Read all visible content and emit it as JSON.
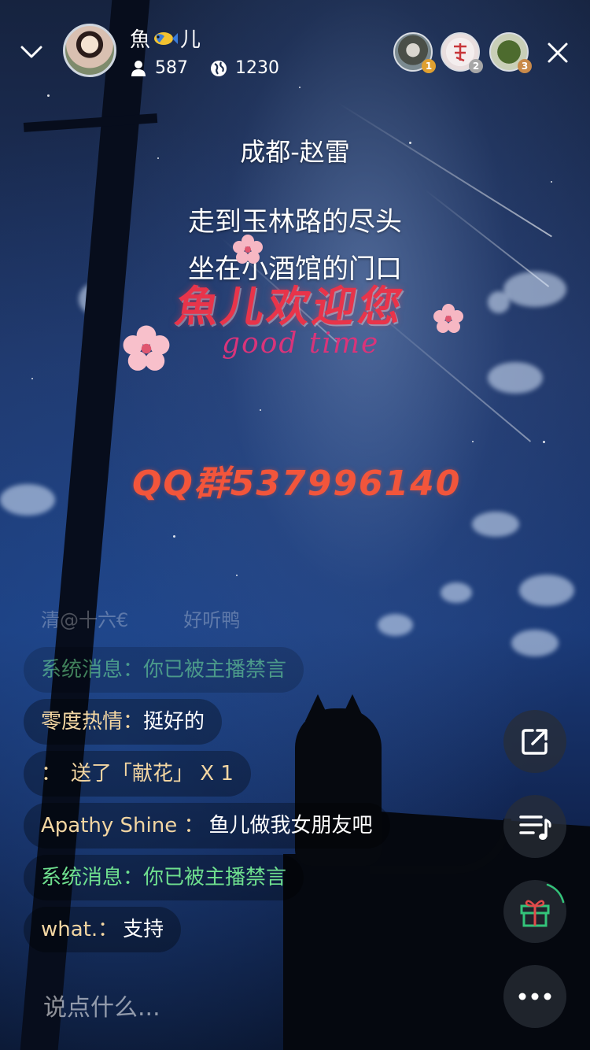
{
  "header": {
    "anchor_name_prefix": "魚",
    "anchor_name_suffix": "儿",
    "fans_count": "587",
    "hot_count": "1230",
    "viewers": [
      {
        "rank": "1",
        "rank_color": "#e0a030"
      },
      {
        "rank": "2",
        "rank_color": "#a7a7a7"
      },
      {
        "rank": "3",
        "rank_color": "#c98a4a"
      }
    ]
  },
  "overlay": {
    "lyric_title": "成都-赵雷",
    "lyric_line1": "走到玉林路的尽头",
    "lyric_line2": "坐在小酒馆的门口",
    "welcome_text": "魚儿欢迎您",
    "welcome_sub": "good time",
    "qq_group": "QQ群537996140"
  },
  "chat": {
    "faded_line_left": "清@十六€",
    "faded_line_right": "好听鸭",
    "messages": [
      {
        "name": "系统消息：",
        "text": "你已被主播禁言",
        "type": "system"
      },
      {
        "name": "零度热情：",
        "text": "挺好的",
        "type": "user"
      },
      {
        "name": "：",
        "text": "送了「献花」 X 1",
        "type": "user"
      },
      {
        "name": "Apathy Shine ：",
        "text": "鱼儿做我女朋友吧",
        "type": "user"
      },
      {
        "name": "系统消息：",
        "text": "你已被主播禁言",
        "type": "system"
      },
      {
        "name": "what.：",
        "text": "支持",
        "type": "user"
      }
    ]
  },
  "input": {
    "placeholder": "说点什么..."
  },
  "icons": {
    "collapse": "chevron-down-icon",
    "close": "close-icon",
    "share": "share-icon",
    "music": "music-playlist-icon",
    "gift": "gift-icon",
    "more": "more-icon",
    "fans": "person-icon",
    "hot": "globe-icon"
  },
  "colors": {
    "system_message": "#6fe08f",
    "user_name": "#f3d6a2",
    "welcome": "#e8344a",
    "qq_group": "#f2553b",
    "gift_icon": "#33c47a"
  }
}
